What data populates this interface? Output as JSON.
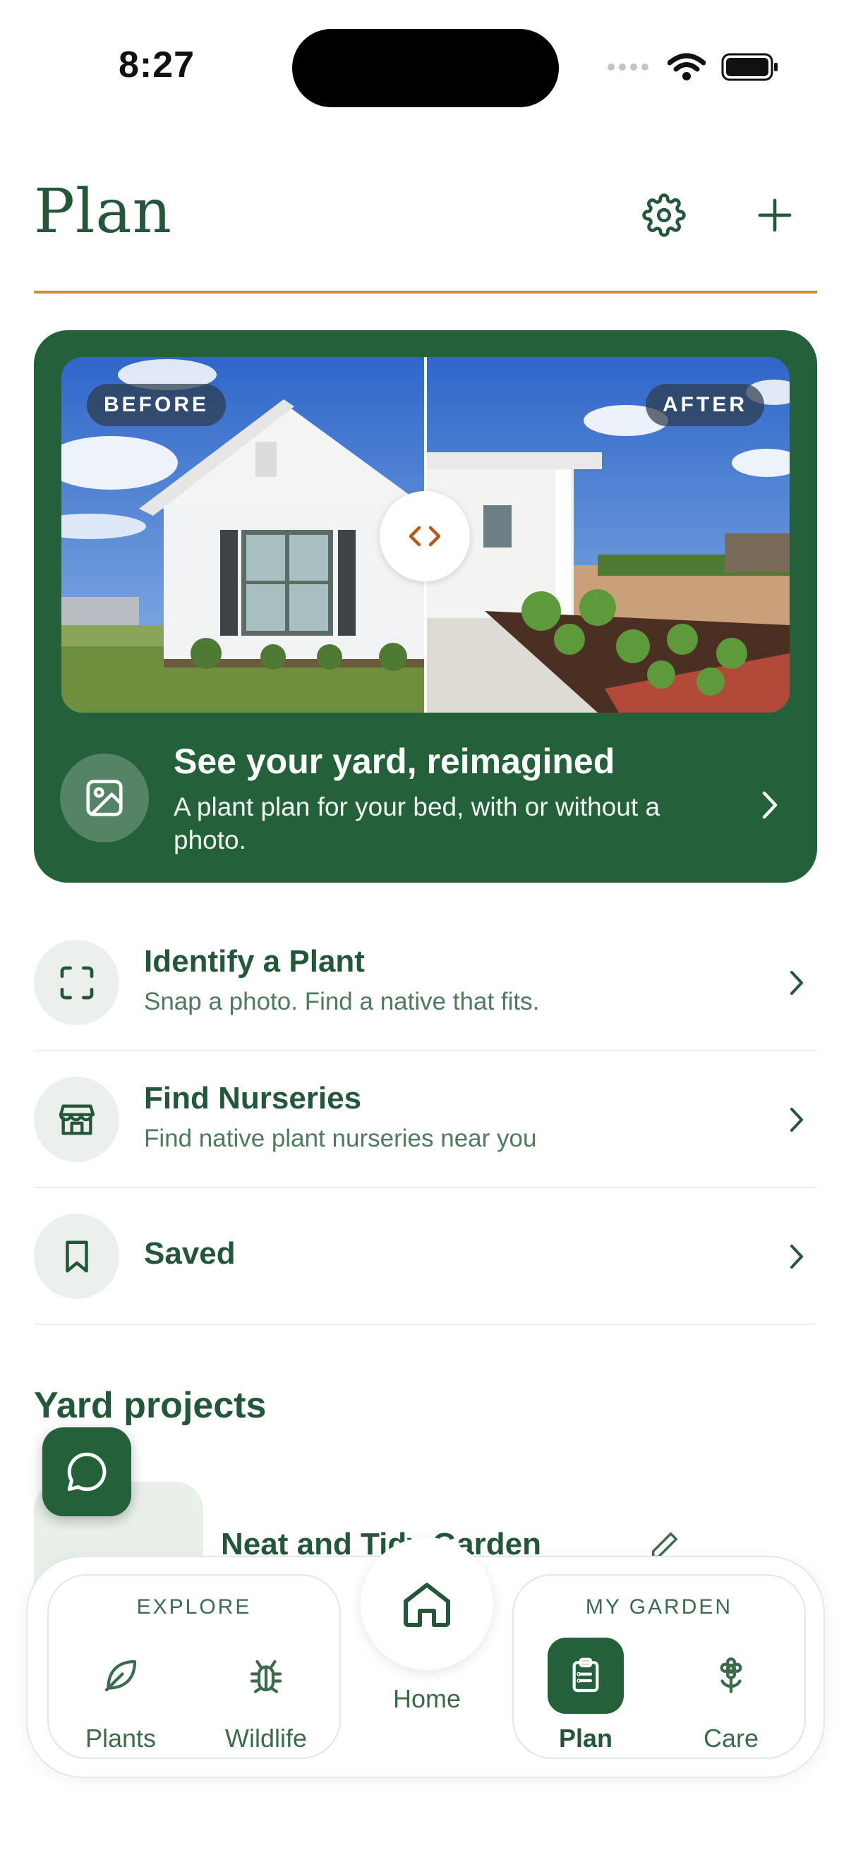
{
  "status_bar": {
    "time": "8:27"
  },
  "header": {
    "title": "Plan",
    "settings_icon": "gear-icon",
    "add_icon": "plus-icon"
  },
  "hero": {
    "before_label": "BEFORE",
    "after_label": "AFTER",
    "title": "See your yard, reimagined",
    "subtitle": "A plant plan for your bed, with or without a photo."
  },
  "actions": [
    {
      "title": "Identify a Plant",
      "subtitle": "Snap a photo. Find a native that fits.",
      "icon": "scan-frame-icon"
    },
    {
      "title": "Find Nurseries",
      "subtitle": "Find native plant nurseries near you",
      "icon": "storefront-icon"
    },
    {
      "title": "Saved",
      "icon": "bookmark-icon"
    }
  ],
  "projects": {
    "section_title": "Yard projects",
    "items": [
      {
        "name": "Neat and Tidy Garden"
      }
    ]
  },
  "bottom_nav": {
    "explore_label": "EXPLORE",
    "garden_label": "MY GARDEN",
    "items": [
      {
        "label": "Plants",
        "icon": "leaf-icon"
      },
      {
        "label": "Wildlife",
        "icon": "bug-icon"
      },
      {
        "label": "Home",
        "icon": "home-icon"
      },
      {
        "label": "Plan",
        "icon": "clipboard-list-icon",
        "active": true
      },
      {
        "label": "Care",
        "icon": "flower-icon"
      }
    ]
  },
  "colors": {
    "primary_green": "#24603a",
    "text_green": "#24573a",
    "accent_orange": "#d4873b",
    "handle_orange": "#b45a1e"
  }
}
